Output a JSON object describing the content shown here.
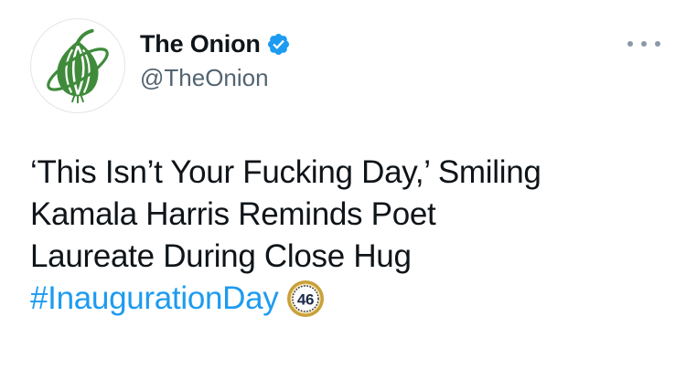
{
  "author": {
    "display_name": "The Onion",
    "handle": "@TheOnion",
    "verified": true,
    "avatar_icon": "onion-logo-icon",
    "verified_icon": "verified-badge-icon"
  },
  "menu": {
    "icon": "more-options-icon"
  },
  "tweet": {
    "lines": [
      "‘This Isn’t Your Fucking Day,’ Smiling",
      "Kamala Harris Reminds Poet",
      "Laureate During Close Hug"
    ],
    "hashtag": "#InaugurationDay",
    "hashflag_text": "46",
    "hashflag_icon": "inauguration-46-hashflag-icon"
  },
  "colors": {
    "text": "#0f1419",
    "secondary_text": "#536471",
    "link": "#1d9bf0",
    "verified": "#1d9bf0",
    "onion_green": "#3f8b3b",
    "hashflag_gold": "#c9a13b",
    "hashflag_navy": "#1c2a4a"
  }
}
